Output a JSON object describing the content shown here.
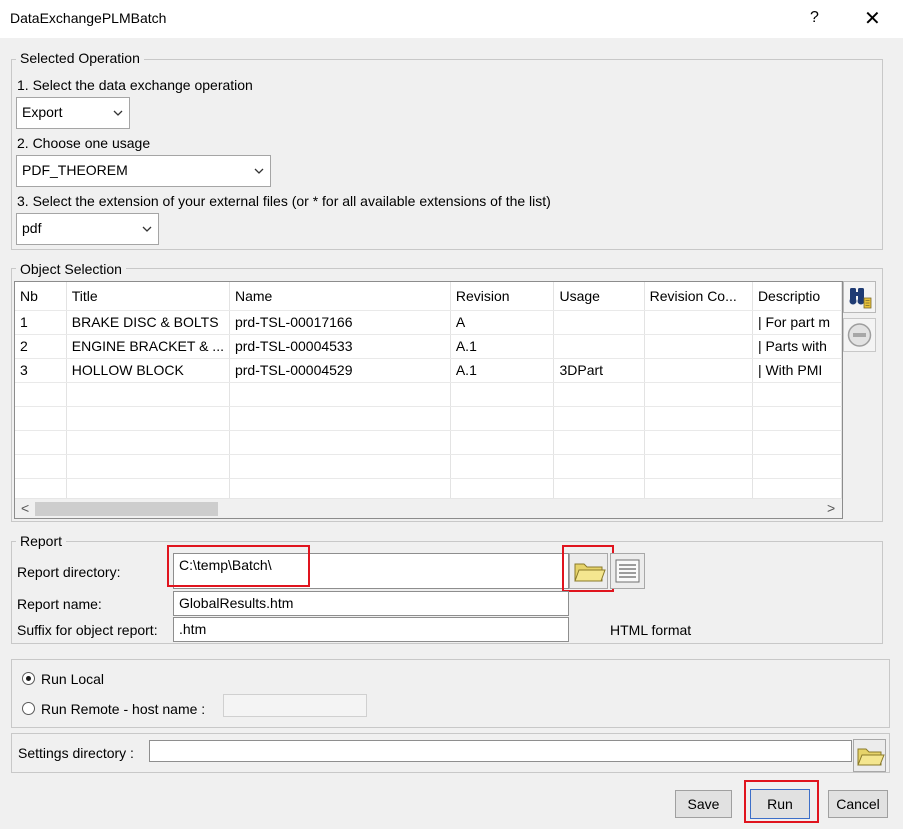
{
  "window": {
    "title": "DataExchangePLMBatch",
    "help_label": "?",
    "close_label": "✕"
  },
  "selected_operation": {
    "legend": "Selected Operation",
    "step1_label": "1. Select the data exchange operation",
    "operation_value": "Export",
    "step2_label": "2. Choose one usage",
    "usage_value": "PDF_THEOREM",
    "step3_label": "3. Select the extension of your external files (or * for all available extensions of the list)",
    "extension_value": "pdf"
  },
  "object_selection": {
    "legend": "Object Selection",
    "columns": [
      "Nb",
      "Title",
      "Name",
      "Revision",
      "Usage",
      "Revision Co...",
      "Descriptio"
    ],
    "rows": [
      [
        "1",
        "BRAKE DISC & BOLTS",
        "prd-TSL-00017166",
        "A",
        "",
        "",
        "| For part m"
      ],
      [
        "2",
        "ENGINE BRACKET & ...",
        "prd-TSL-00004533",
        "A.1",
        "",
        "",
        "| Parts with"
      ],
      [
        "3",
        "HOLLOW BLOCK",
        "prd-TSL-00004529",
        "A.1",
        "3DPart",
        "",
        "| With PMI"
      ]
    ],
    "empty_rows": 5,
    "scroll_left": "<",
    "scroll_right": ">"
  },
  "report": {
    "legend": "Report",
    "directory_label": "Report directory:",
    "directory_value": "C:\\temp\\Batch\\",
    "name_label": "Report name:",
    "name_value": "GlobalResults.htm",
    "suffix_label": "Suffix for object report:",
    "suffix_value": ".htm",
    "format_label": "HTML format"
  },
  "run_mode": {
    "local_label": "Run Local",
    "remote_label": "Run Remote - host name :",
    "host_value": "",
    "selected": "local"
  },
  "settings": {
    "label": "Settings directory :",
    "value": ""
  },
  "buttons": {
    "save": "Save",
    "run": "Run",
    "cancel": "Cancel"
  },
  "icons": {
    "search": "binoculars-search-icon",
    "remove": "remove-minus-icon",
    "browse": "folder-open-icon",
    "list": "report-list-icon"
  },
  "colors": {
    "highlight": "#e0141e",
    "selection_box": "#3c6ec8"
  }
}
